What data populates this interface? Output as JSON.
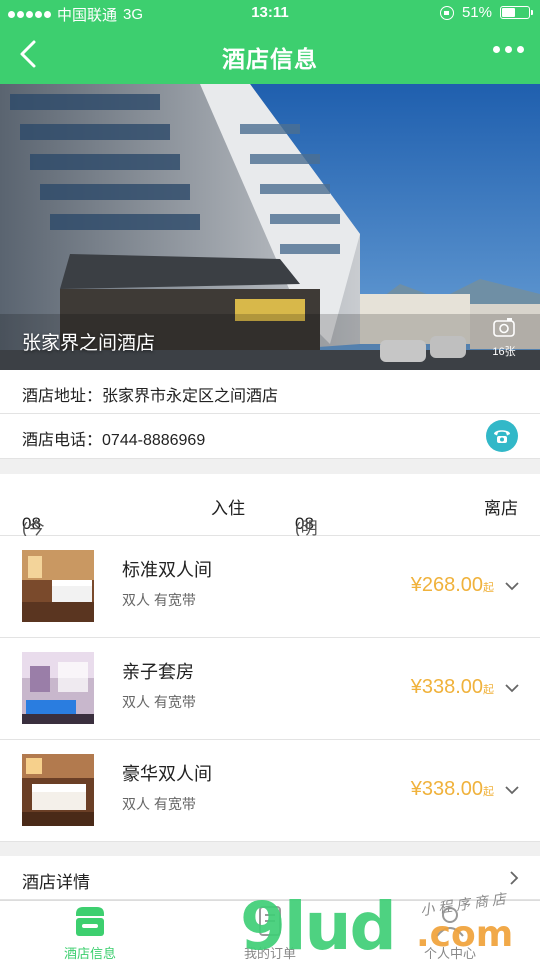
{
  "status_bar": {
    "carrier": "中国联通",
    "network": "3G",
    "time": "13:11",
    "battery": "51%",
    "battery_level": 0.51
  },
  "nav": {
    "title": "酒店信息"
  },
  "hero": {
    "hotel_name": "张家界之间酒店",
    "photo_count": "16张"
  },
  "info": {
    "address_label": "酒店地址：",
    "address": "张家界市永定区之间酒店",
    "phone_label": "酒店电话：",
    "phone": "0744-8886969"
  },
  "dates": {
    "checkin_date": "08月07日",
    "checkin_day": "(今天)",
    "checkin_label": "入住",
    "checkout_date": "08月08日",
    "checkout_day": "(明天)",
    "checkout_label": "离店"
  },
  "rooms": [
    {
      "name": "标准双人间",
      "desc": "双人 有宽带",
      "price": "¥268.00",
      "suffix": "起"
    },
    {
      "name": "亲子套房",
      "desc": "双人 有宽带",
      "price": "¥338.00",
      "suffix": "起"
    },
    {
      "name": "豪华双人间",
      "desc": "双人 有宽带",
      "price": "¥338.00",
      "suffix": "起"
    }
  ],
  "detail": {
    "label": "酒店详情"
  },
  "tabs": [
    {
      "label": "酒店信息",
      "icon": "shop-icon",
      "active": true
    },
    {
      "label": "我的订单",
      "icon": "order-icon",
      "active": false
    },
    {
      "label": "个人中心",
      "icon": "user-icon",
      "active": false
    }
  ],
  "watermark": {
    "brand": "9lud",
    "tld": ".com",
    "script": "小程序商店"
  },
  "colors": {
    "primary": "#3dcf6f",
    "price": "#f0b23c",
    "phone_button": "#32b8c8",
    "divider": "#f0f0f0"
  }
}
